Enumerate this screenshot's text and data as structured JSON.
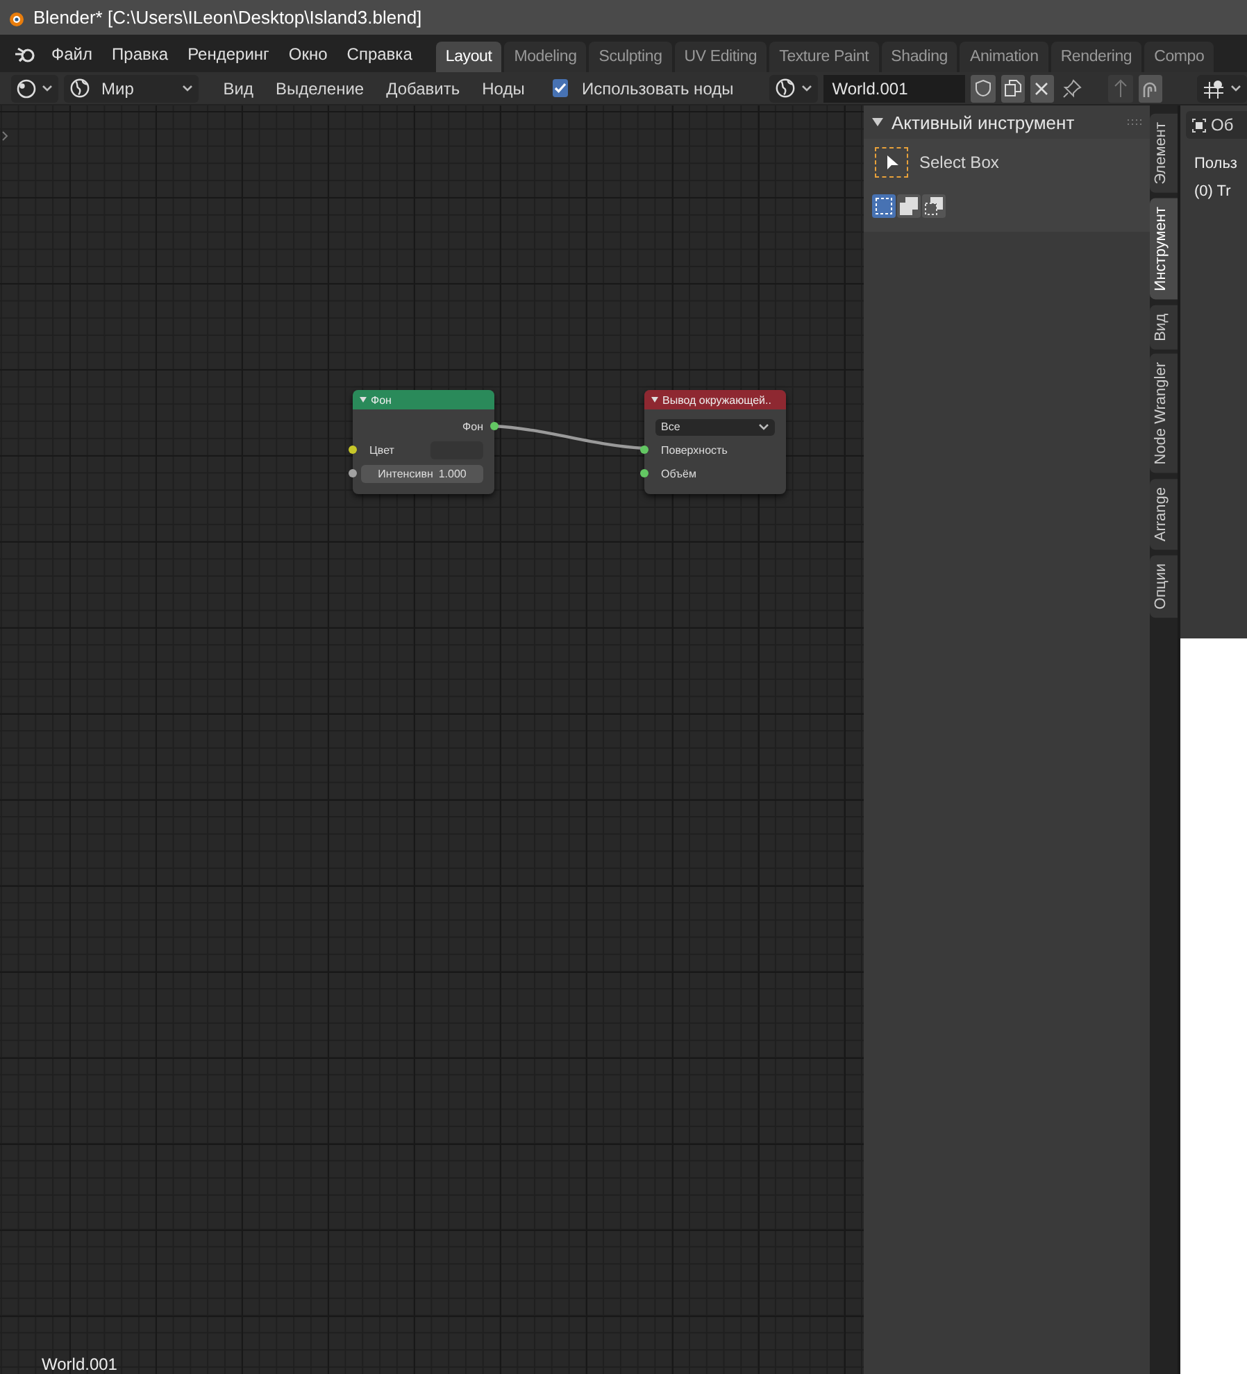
{
  "title_bar": {
    "title": "Blender* [C:\\Users\\ILeon\\Desktop\\Island3.blend]"
  },
  "menu_bar": {
    "menus": [
      "Файл",
      "Правка",
      "Рендеринг",
      "Окно",
      "Справка"
    ],
    "workspaces": [
      {
        "label": "Layout",
        "selected": true
      },
      {
        "label": "Modeling",
        "selected": false
      },
      {
        "label": "Sculpting",
        "selected": false
      },
      {
        "label": "UV Editing",
        "selected": false
      },
      {
        "label": "Texture Paint",
        "selected": false
      },
      {
        "label": "Shading",
        "selected": false
      },
      {
        "label": "Animation",
        "selected": false
      },
      {
        "label": "Rendering",
        "selected": false
      },
      {
        "label": "Compo",
        "selected": false
      }
    ]
  },
  "header": {
    "shader_type": "Мир",
    "menus": [
      "Вид",
      "Выделение",
      "Добавить",
      "Ноды"
    ],
    "use_nodes": {
      "label": "Использовать ноды",
      "checked": true
    },
    "world": {
      "value": "World.001"
    }
  },
  "node_editor": {
    "nodes": [
      {
        "title": "Фон",
        "kind": "background",
        "rows": [
          {
            "kind": "output",
            "label": "Фон",
            "color": "#63c763"
          },
          {
            "kind": "color_input",
            "label": "Цвет",
            "color": "#c7c729"
          },
          {
            "kind": "value_input",
            "label": "Интенсивн",
            "value": "1.000",
            "color": "#a1a1a1"
          }
        ]
      },
      {
        "title": "Вывод окружающей..",
        "kind": "output",
        "rows": [
          {
            "kind": "dropdown",
            "value": "Все"
          },
          {
            "kind": "input",
            "label": "Поверхность",
            "color": "#63c763"
          },
          {
            "kind": "input",
            "label": "Объём",
            "color": "#63c763"
          }
        ]
      }
    ],
    "footer": "World.001"
  },
  "sidebar": {
    "panel": {
      "title": "Активный инструмент",
      "expanded": true,
      "tool": "Select Box",
      "modes": [
        {
          "selected": true
        },
        {
          "selected": false
        },
        {
          "selected": false
        }
      ]
    },
    "tabs": [
      {
        "label": "Элемент",
        "selected": false
      },
      {
        "label": "Инструмент",
        "selected": true
      },
      {
        "label": "Вид",
        "selected": false
      },
      {
        "label": "Node Wrangler",
        "selected": false
      },
      {
        "label": "Arrange",
        "selected": false
      },
      {
        "label": "Опции",
        "selected": false
      }
    ]
  },
  "viewport": {
    "mode_label": "Об",
    "texts": [
      "Польз",
      "(0) Tr"
    ]
  }
}
